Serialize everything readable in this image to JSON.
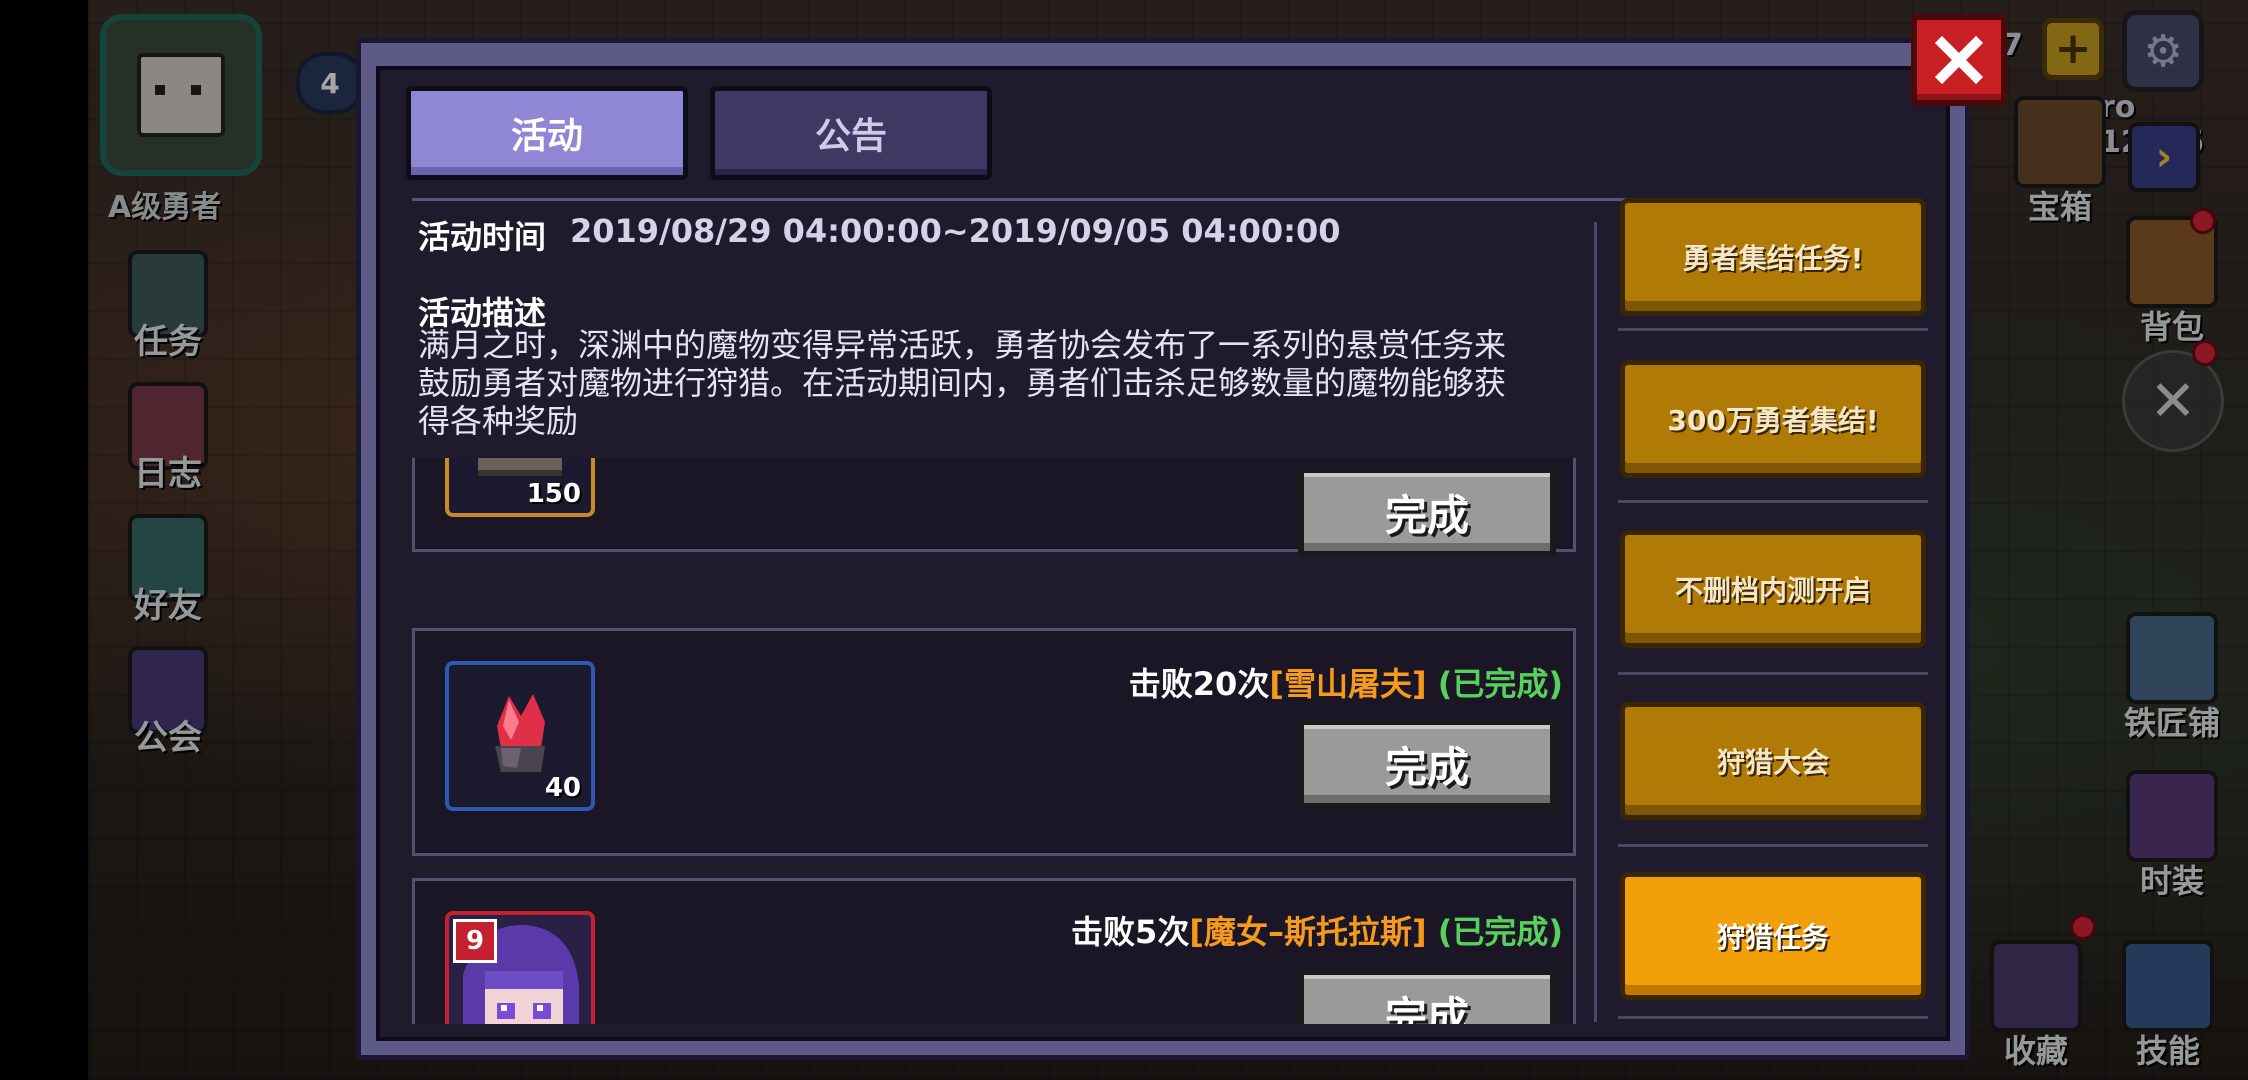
{
  "hud_left": {
    "level": "4",
    "hero_rank": "A级勇者",
    "buttons": [
      {
        "label": "任务",
        "icon": "quest-scroll-icon"
      },
      {
        "label": "日志",
        "icon": "journal-icon"
      },
      {
        "label": "好友",
        "icon": "friends-icon"
      },
      {
        "label": "公会",
        "icon": "guild-banner-icon"
      }
    ]
  },
  "hud_right": {
    "currency_partial": "ro 12475",
    "top_counter": "7",
    "buttons": [
      {
        "label": "宝箱",
        "icon": "treasure-chest-icon"
      },
      {
        "label": "背包",
        "icon": "backpack-icon"
      },
      {
        "label": "铁匠铺",
        "icon": "anvil-icon"
      },
      {
        "label": "时装",
        "icon": "costume-icon"
      },
      {
        "label": "收藏",
        "icon": "collection-icon"
      },
      {
        "label": "技能",
        "icon": "skill-gem-icon"
      }
    ]
  },
  "modal": {
    "tabs": [
      {
        "label": "活动",
        "active": true
      },
      {
        "label": "公告",
        "active": false
      }
    ],
    "time_label": "活动时间",
    "time_value": "2019/08/29 04:00:00~2019/09/05 04:00:00",
    "desc_label": "活动描述",
    "desc_lines": [
      "满月之时，深渊中的魔物变得异常活跃，勇者协会发布了一系列的悬赏任务来",
      "鼓励勇者对魔物进行狩猎。在活动期间内，勇者们击杀足够数量的魔物能够获",
      "得各种奖励"
    ],
    "tasks": [
      {
        "item_icon": "orange-ore-pile-icon",
        "item_count": "150",
        "frame_color": "#c98a2a",
        "button": "完成"
      },
      {
        "req_prefix": "击败20次",
        "req_target": "[雪山屠夫]",
        "req_status": "(已完成)",
        "item_icon": "red-crystal-icon",
        "item_count": "40",
        "frame_color": "#2d5bb0",
        "button": "完成"
      },
      {
        "req_prefix": "击败5次",
        "req_target": "[魔女–斯托拉斯]",
        "req_status": "(已完成)",
        "item_icon": "purple-hair-hero-portrait-icon",
        "item_level": "9",
        "frame_color": "#c42030",
        "button": "完成"
      }
    ],
    "events": [
      {
        "label": "勇者集结任务!",
        "active": false
      },
      {
        "label": "300万勇者集结!",
        "active": false
      },
      {
        "label": "不删档内测开启",
        "active": false
      },
      {
        "label": "狩猎大会",
        "active": false
      },
      {
        "label": "狩猎任务",
        "active": true
      }
    ]
  },
  "colors": {
    "modal_frame": "#5e5a87",
    "modal_bg": "#1f1a2c",
    "tab_active": "#8f86d6",
    "tab_inactive": "#3f3862",
    "event_button": "#b07a06",
    "event_button_active": "#f2a00a",
    "target_name": "#f59a1a",
    "completed": "#58d05c",
    "close_button": "#c71f24"
  }
}
